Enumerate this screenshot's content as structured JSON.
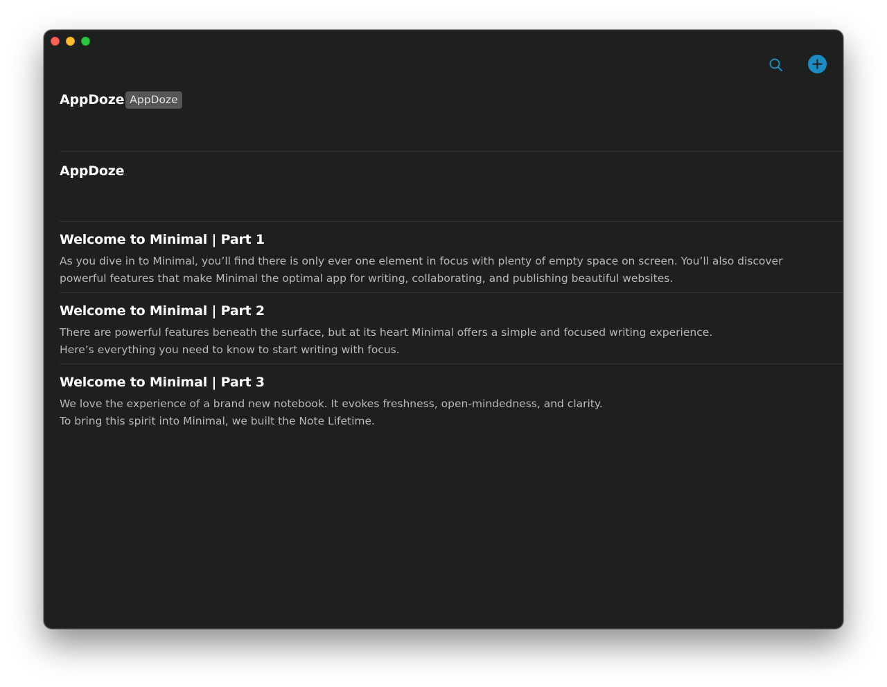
{
  "window": {
    "controls": [
      "close",
      "minimize",
      "maximize"
    ]
  },
  "toolbar": {
    "search_icon": "search-icon",
    "add_icon": "plus-circle-icon",
    "accent_color": "#1a8cc1"
  },
  "notes": [
    {
      "title": "AppDoze",
      "tag": "AppDoze",
      "body": ""
    },
    {
      "title": "AppDoze",
      "body": ""
    },
    {
      "title": "Welcome to Minimal | Part 1",
      "body": "As you dive in to Minimal, you’ll find there is only ever one element in focus with plenty of empty space on screen. You’ll also discover powerful features that make Minimal the optimal app for writing, collaborating, and publishing beautiful websites."
    },
    {
      "title": "Welcome to Minimal | Part 2",
      "body": "There are powerful features beneath the surface, but at its heart Minimal offers a simple and focused writing experience.\nHere’s everything you need to know to start writing with focus."
    },
    {
      "title": "Welcome to Minimal | Part 3",
      "body": "We love the experience of a brand new notebook. It evokes freshness, open-mindedness, and clarity.\nTo bring this spirit into Minimal, we built the Note Lifetime."
    }
  ]
}
